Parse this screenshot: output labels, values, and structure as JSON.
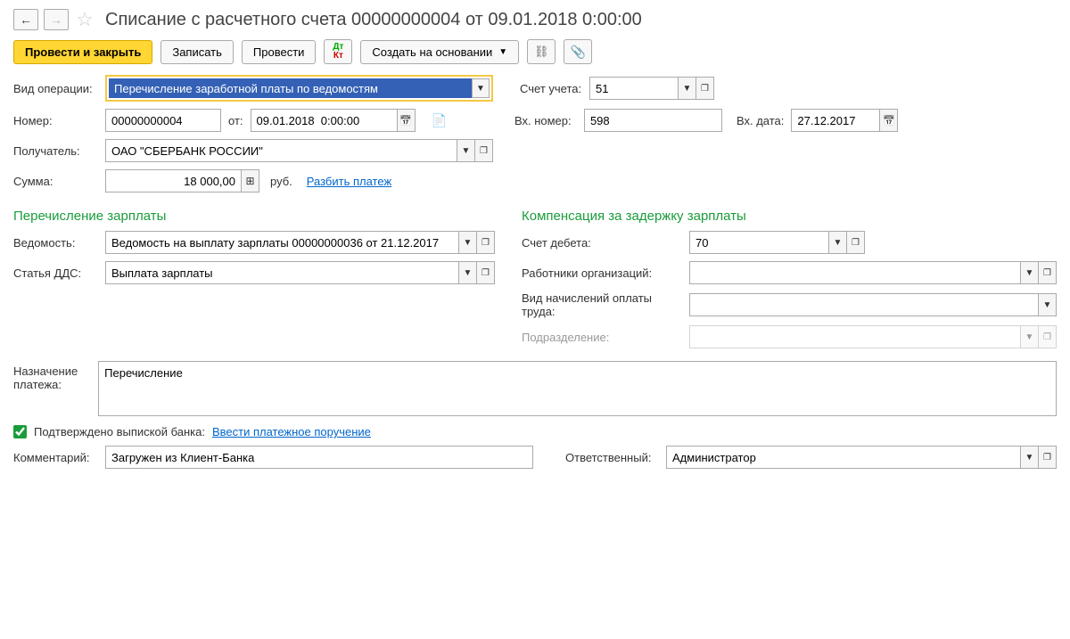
{
  "header": {
    "title": "Списание с расчетного счета 00000000004 от 09.01.2018 0:00:00"
  },
  "toolbar": {
    "post_and_close": "Провести и закрыть",
    "save": "Записать",
    "post": "Провести",
    "create_based_on": "Создать на основании"
  },
  "operation": {
    "label": "Вид операции:",
    "value": "Перечисление заработной платы по ведомостям",
    "account_label": "Счет учета:",
    "account_value": "51"
  },
  "doc": {
    "number_label": "Номер:",
    "number_value": "00000000004",
    "from_label": "от:",
    "date_value": "09.01.2018  0:00:00",
    "in_number_label": "Вх. номер:",
    "in_number_value": "598",
    "in_date_label": "Вх. дата:",
    "in_date_value": "27.12.2017"
  },
  "recipient": {
    "label": "Получатель:",
    "value": "ОАО \"СБЕРБАНК РОССИИ\""
  },
  "amount": {
    "label": "Сумма:",
    "value": "18 000,00",
    "currency": "руб.",
    "split_link": "Разбить платеж"
  },
  "sections": {
    "salary_title": "Перечисление зарплаты",
    "compensation_title": "Компенсация за задержку зарплаты"
  },
  "salary": {
    "statement_label": "Ведомость:",
    "statement_value": "Ведомость на выплату зарплаты 00000000036 от 21.12.2017",
    "dds_label": "Статья ДДС:",
    "dds_value": "Выплата зарплаты"
  },
  "compensation": {
    "debit_label": "Счет дебета:",
    "debit_value": "70",
    "employees_label": "Работники организаций:",
    "employees_value": "",
    "accrual_label": "Вид начислений оплаты труда:",
    "accrual_value": "",
    "department_label": "Подразделение:",
    "department_value": ""
  },
  "purpose": {
    "label": "Назначение платежа:",
    "value": "Перечисление"
  },
  "confirm": {
    "label": "Подтверждено выпиской банка:",
    "link": "Ввести платежное поручение"
  },
  "comment": {
    "label": "Комментарий:",
    "value": "Загружен из Клиент-Банка",
    "responsible_label": "Ответственный:",
    "responsible_value": "Администратор"
  }
}
